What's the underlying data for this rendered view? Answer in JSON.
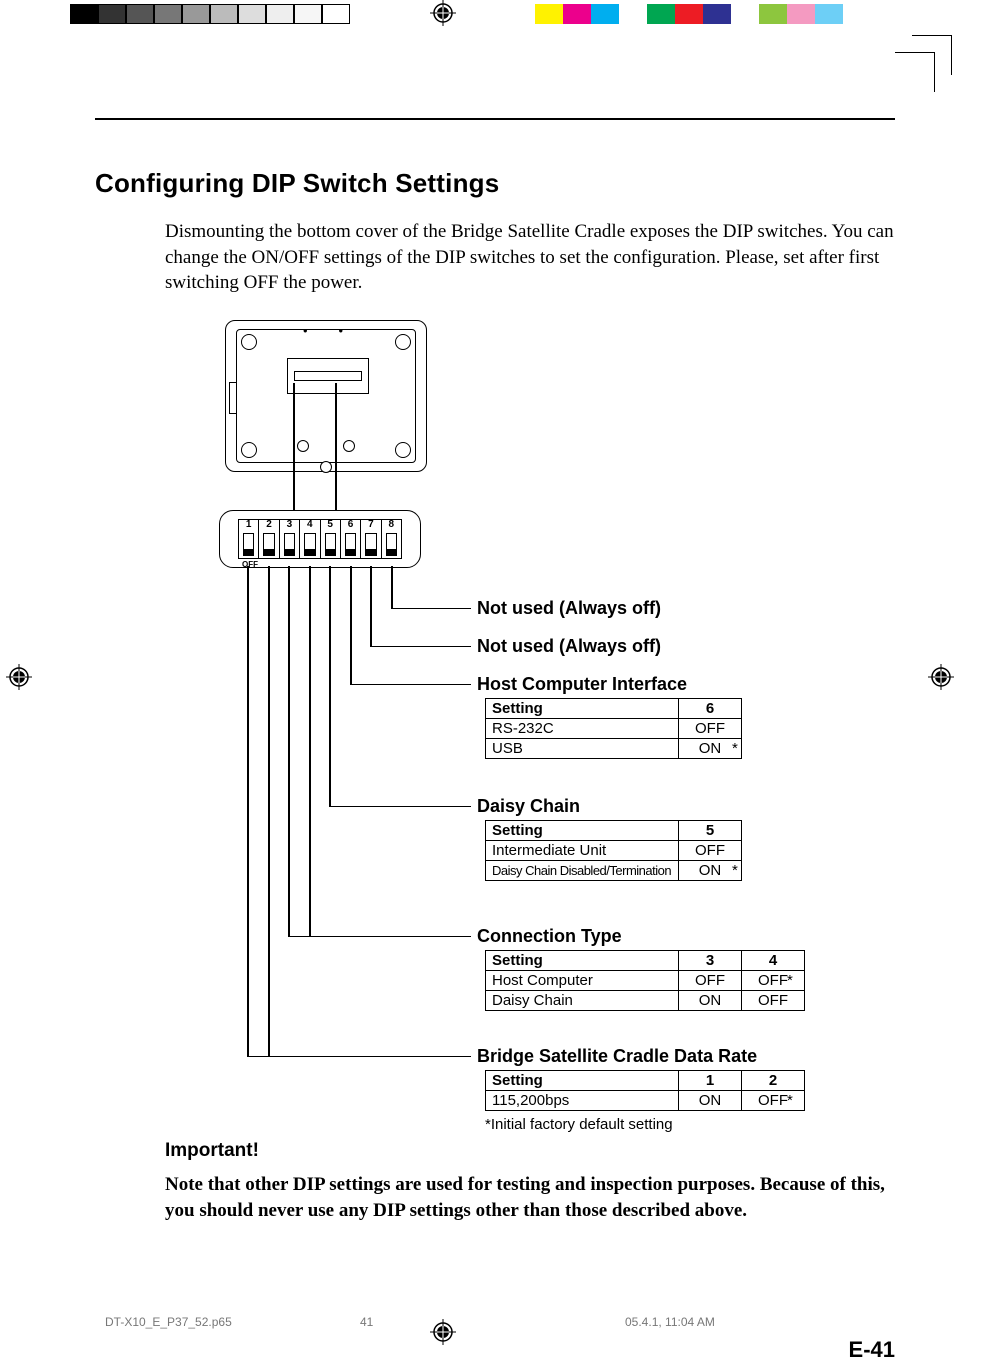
{
  "header_swatches_left": [
    "#000000",
    "#333333",
    "#555555",
    "#777777",
    "#999999",
    "#bbbbbb",
    "#dddddd",
    "#eeeeee",
    "#f6f6f6",
    "#ffffff"
  ],
  "header_swatches_right": [
    "#fff200",
    "#ec008c",
    "#00aeef",
    "#ffffff",
    "#00a651",
    "#ed1c24",
    "#2e3192",
    "#ffffff",
    "#8dc63e",
    "#f49ac1",
    "#6dcff6",
    "#ffffff"
  ],
  "heading": "Configuring DIP Switch Settings",
  "intro": "Dismounting the bottom cover of the Bridge Satellite Cradle exposes the DIP switches. You can change the ON/OFF settings of the DIP switches to set the configuration. Please, set after first switching OFF the power.",
  "dip_numbers": [
    "1",
    "2",
    "3",
    "4",
    "5",
    "6",
    "7",
    "8"
  ],
  "dip_off_label": "OFF",
  "labels": {
    "not_used_off_1": "Not used (Always off)",
    "not_used_off_2": "Not used (Always off)",
    "host_computer_interface": "Host Computer Interface",
    "daisy_chain": "Daisy Chain",
    "connection_type": "Connection Type",
    "data_rate": "Bridge Satellite Cradle Data Rate"
  },
  "tables": {
    "host": {
      "headers": [
        "Setting",
        "6"
      ],
      "rows": [
        [
          "RS-232C",
          "OFF"
        ],
        [
          "USB",
          "ON"
        ]
      ],
      "star_row": 1
    },
    "daisy": {
      "headers": [
        "Setting",
        "5"
      ],
      "rows": [
        [
          "Intermediate Unit",
          "OFF"
        ],
        [
          "Daisy Chain Disabled/Termination",
          "ON"
        ]
      ],
      "star_row": 1
    },
    "connection": {
      "headers": [
        "Setting",
        "3",
        "4"
      ],
      "rows": [
        [
          "Host Computer",
          "OFF",
          "OFF"
        ],
        [
          "Daisy Chain",
          "ON",
          "OFF"
        ]
      ],
      "star_row": 0
    },
    "rate": {
      "headers": [
        "Setting",
        "1",
        "2"
      ],
      "rows": [
        [
          "115,200bps",
          "ON",
          "OFF"
        ]
      ],
      "star_row": 0
    }
  },
  "footnote": "*Initial factory default setting",
  "important_heading": "Important!",
  "important_text": "Note that other DIP settings are used for testing and inspection purposes. Because of this, you should never use any DIP settings other than those described above.",
  "page_number": "E-41",
  "footer": {
    "filename": "DT-X10_E_P37_52.p65",
    "page": "41",
    "datetime": "05.4.1, 11:04 AM"
  }
}
